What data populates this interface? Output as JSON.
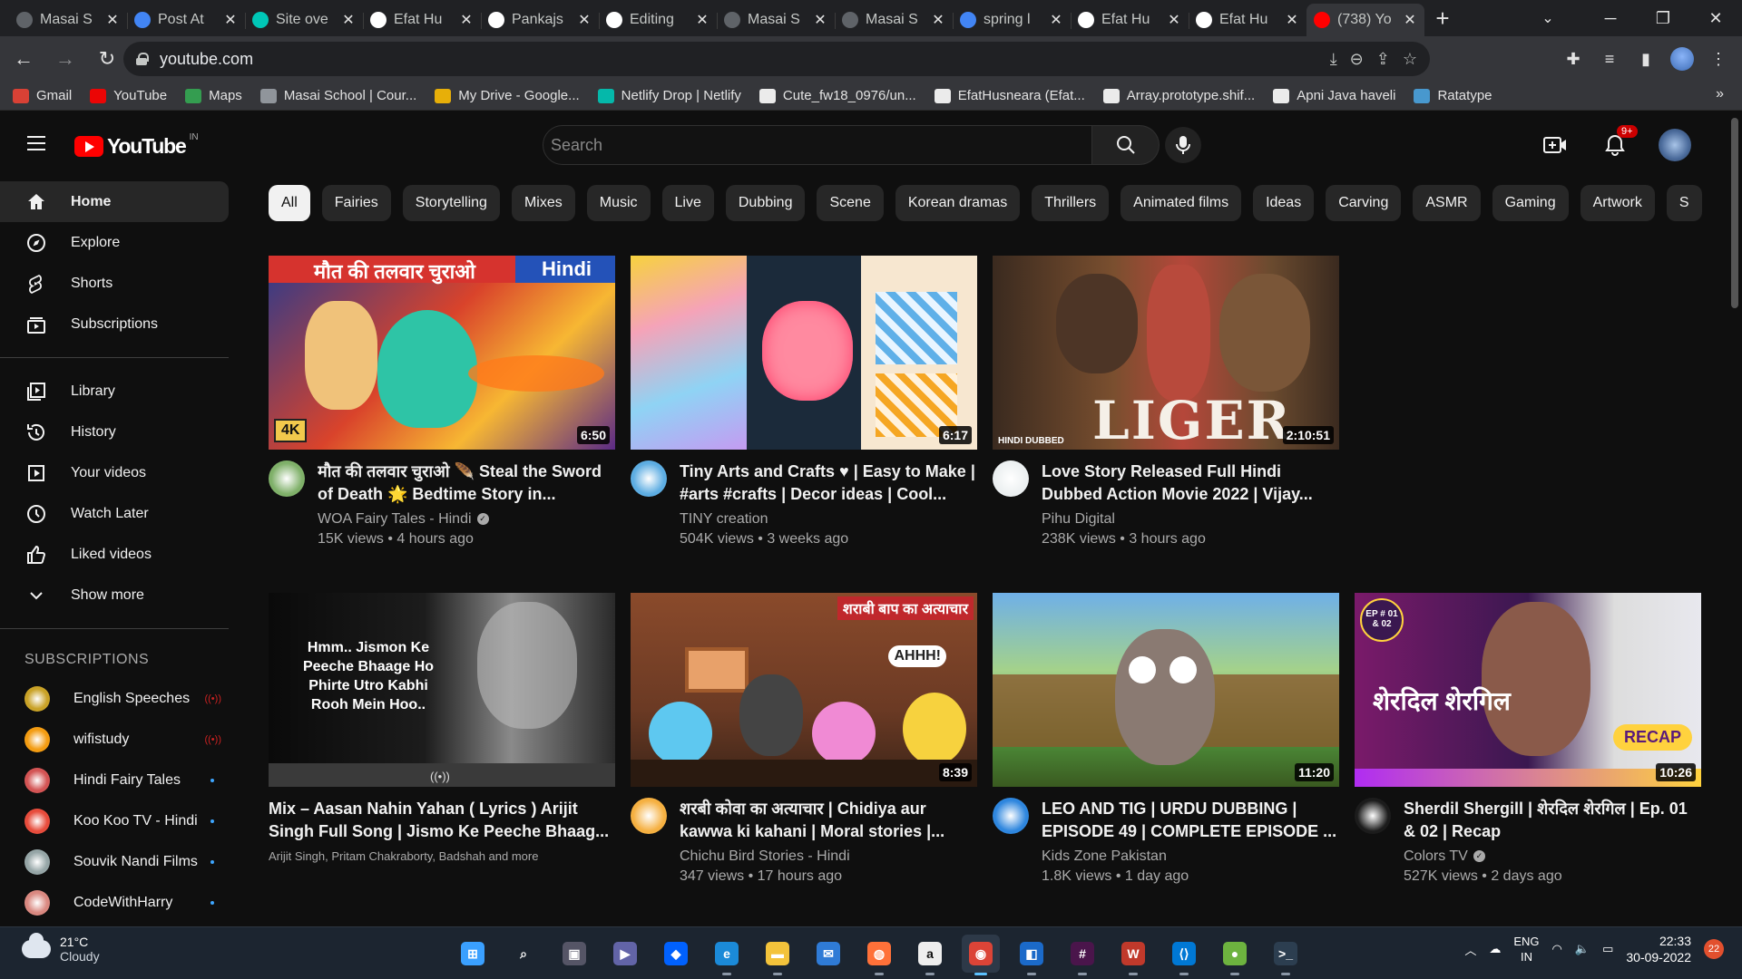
{
  "browser": {
    "tabs": [
      {
        "title": "Masai S",
        "favicon_color": "#5f6368"
      },
      {
        "title": "Post At",
        "favicon_color": "#4285f4"
      },
      {
        "title": "Site ove",
        "favicon_color": "#00c7b7"
      },
      {
        "title": "Efat Hu",
        "favicon_color": "#ffffff"
      },
      {
        "title": "Pankajs",
        "favicon_color": "#ffffff"
      },
      {
        "title": "Editing",
        "favicon_color": "#ffffff"
      },
      {
        "title": "Masai S",
        "favicon_color": "#5f6368"
      },
      {
        "title": "Masai S",
        "favicon_color": "#5f6368"
      },
      {
        "title": "spring l",
        "favicon_color": "#4285f4"
      },
      {
        "title": "Efat Hu",
        "favicon_color": "#ffffff"
      },
      {
        "title": "Efat Hu",
        "favicon_color": "#ffffff"
      },
      {
        "title": "(738) Yo",
        "favicon_color": "#ff0000"
      }
    ],
    "url": "youtube.com",
    "bookmarks": [
      {
        "label": "Gmail",
        "icon": "gmail-icon",
        "color": "#ea4335"
      },
      {
        "label": "YouTube",
        "icon": "youtube-icon",
        "color": "#ff0000"
      },
      {
        "label": "Maps",
        "icon": "maps-icon",
        "color": "#34a853"
      },
      {
        "label": "Masai School | Cour...",
        "icon": "globe-icon",
        "color": "#9aa0a6"
      },
      {
        "label": "My Drive - Google...",
        "icon": "drive-icon",
        "color": "#fbbc04"
      },
      {
        "label": "Netlify Drop | Netlify",
        "icon": "netlify-icon",
        "color": "#00c7b7"
      },
      {
        "label": "Cute_fw18_0976/un...",
        "icon": "github-icon",
        "color": "#ffffff"
      },
      {
        "label": "EfatHusneara (Efat...",
        "icon": "hashnode-icon",
        "color": "#ffffff"
      },
      {
        "label": "Array.prototype.shif...",
        "icon": "mdn-icon",
        "color": "#ffffff"
      },
      {
        "label": "Apni Java haveli",
        "icon": "notion-icon",
        "color": "#ffffff"
      },
      {
        "label": "Ratatype",
        "icon": "ratatype-icon",
        "color": "#4aa3df"
      }
    ]
  },
  "youtube": {
    "logo_text": "YouTube",
    "country_code": "IN",
    "search_placeholder": "Search",
    "notification_count": "9+",
    "sidebar_main": [
      {
        "label": "Home",
        "icon": "home-icon",
        "active": true
      },
      {
        "label": "Explore",
        "icon": "compass-icon"
      },
      {
        "label": "Shorts",
        "icon": "shorts-icon"
      },
      {
        "label": "Subscriptions",
        "icon": "subscriptions-icon"
      }
    ],
    "sidebar_library": [
      {
        "label": "Library",
        "icon": "library-icon"
      },
      {
        "label": "History",
        "icon": "history-icon"
      },
      {
        "label": "Your videos",
        "icon": "play-square-icon"
      },
      {
        "label": "Watch Later",
        "icon": "clock-icon"
      },
      {
        "label": "Liked videos",
        "icon": "thumbs-up-icon"
      },
      {
        "label": "Show more",
        "icon": "chevron-down-icon"
      }
    ],
    "subscriptions_heading": "SUBSCRIPTIONS",
    "subscriptions": [
      {
        "name": "English Speeches",
        "indicator": "live",
        "avatar_color": "#c9a227"
      },
      {
        "name": "wifistudy",
        "indicator": "live",
        "avatar_color": "#f39c12"
      },
      {
        "name": "Hindi Fairy Tales",
        "indicator": "dot",
        "avatar_color": "#d35454"
      },
      {
        "name": "Koo Koo TV - Hindi",
        "indicator": "dot",
        "avatar_color": "#e74c3c"
      },
      {
        "name": "Souvik Nandi Films",
        "indicator": "dot",
        "avatar_color": "#95a5a6"
      },
      {
        "name": "CodeWithHarry",
        "indicator": "dot",
        "avatar_color": "#d98880"
      }
    ],
    "chips": [
      "All",
      "Fairies",
      "Storytelling",
      "Mixes",
      "Music",
      "Live",
      "Dubbing",
      "Scene",
      "Korean dramas",
      "Thrillers",
      "Animated films",
      "Ideas",
      "Carving",
      "ASMR",
      "Gaming",
      "Artwork",
      "S"
    ],
    "videos": [
      {
        "title": "मौत की तलवार चुराओ 🪶 Steal the Sword of Death 🌟 Bedtime Story in...",
        "channel": "WOA Fairy Tales - Hindi",
        "verified": true,
        "views": "15K views",
        "age": "4 hours ago",
        "duration": "6:50",
        "thumb_text": "मौत की तलवार चुराओ",
        "thumb_tag": "Hindi",
        "thumb_badge": "4K",
        "avatar_color": "#7fb069"
      },
      {
        "title": "Tiny Arts and Crafts ♥ | Easy to Make | #arts #crafts | Decor ideas | Cool...",
        "channel": "TINY creation",
        "verified": false,
        "views": "504K views",
        "age": "3 weeks ago",
        "duration": "6:17",
        "avatar_color": "#5dade2"
      },
      {
        "title": "Love Story Released Full Hindi Dubbed Action Movie 2022 | Vijay...",
        "channel": "Pihu Digital",
        "verified": false,
        "views": "238K views",
        "age": "3 hours ago",
        "duration": "2:10:51",
        "thumb_text": "LIGER",
        "thumb_tag": "HINDI DUBBED",
        "avatar_color": "#ecf0f1"
      },
      {
        "title": "Mix – Aasan Nahin Yahan ( Lyrics ) Arijit Singh Full Song | Jismo Ke Peeche Bhaag...",
        "channel": "Arijit Singh, Pritam Chakraborty, Badshah and more",
        "verified": false,
        "views": "",
        "age": "",
        "duration": "",
        "thumb_text": "Hmm.. Jismon Ke Peeche Bhaage Ho Phirte Utro Kabhi Rooh Mein Hoo..",
        "thumb_tag": "((•))",
        "avatar_color": ""
      },
      {
        "title": "शरबी कोवा का अत्याचार | Chidiya aur kawwa ki kahani | Moral stories |...",
        "channel": "Chichu Bird Stories - Hindi",
        "verified": false,
        "views": "347 views",
        "age": "17 hours ago",
        "duration": "8:39",
        "thumb_text": "शराबी बाप का अत्याचार",
        "thumb_tag": "AHHH!",
        "avatar_color": "#f5b041"
      },
      {
        "title": "LEO AND TIG | URDU DUBBING | EPISODE 49 | COMPLETE EPISODE ...",
        "channel": "Kids Zone Pakistan",
        "verified": false,
        "views": "1.8K views",
        "age": "1 day ago",
        "duration": "11:20",
        "avatar_color": "#2e86de"
      },
      {
        "title": "Sherdil Shergill | शेरदिल शेरगिल | Ep. 01 & 02 | Recap",
        "channel": "Colors TV",
        "verified": true,
        "views": "527K views",
        "age": "2 days ago",
        "duration": "10:26",
        "thumb_text": "शेरदिल शेरगिल",
        "thumb_tag": "RECAP",
        "thumb_badge": "EP # 01 & 02",
        "avatar_color": "#1c1c1c"
      }
    ]
  },
  "taskbar": {
    "weather_temp": "21°C",
    "weather_cond": "Cloudy",
    "lang_top": "ENG",
    "lang_bottom": "IN",
    "time": "22:33",
    "date": "30-09-2022",
    "notifications": "22",
    "apps": [
      "windows-start",
      "search",
      "task-view",
      "teams",
      "dropbox",
      "edge",
      "file-explorer",
      "mail",
      "firefox",
      "amazon",
      "chrome",
      "remote-desktop",
      "slack",
      "wpm",
      "vscode",
      "springboot",
      "terminal"
    ]
  }
}
